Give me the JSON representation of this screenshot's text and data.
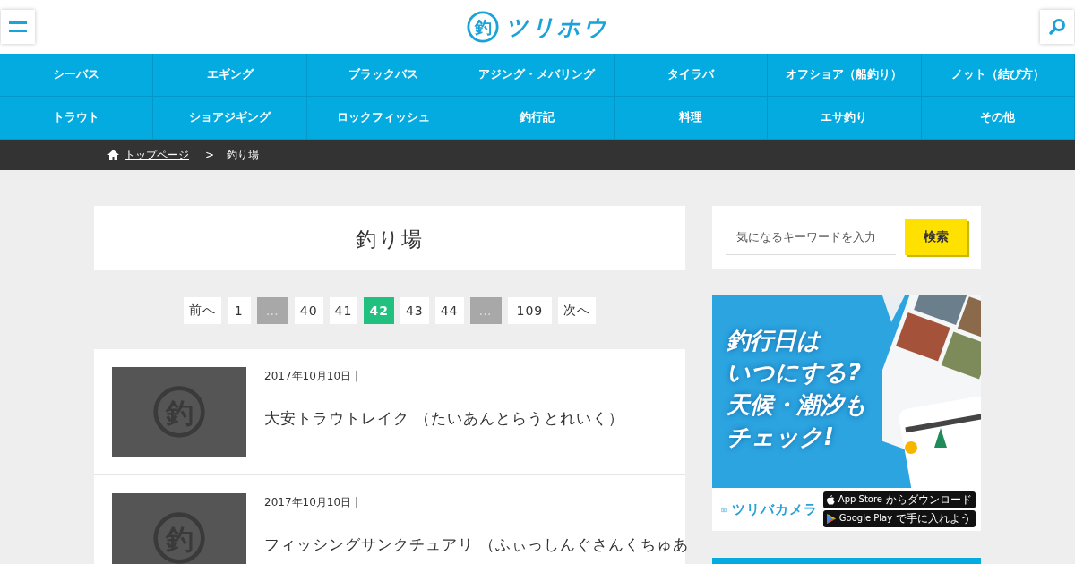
{
  "header": {
    "logo_mark": "釣",
    "logo_text": "ツリホウ"
  },
  "nav": [
    {
      "label": "シーバス"
    },
    {
      "label": "エギング"
    },
    {
      "label": "ブラックバス"
    },
    {
      "label": "アジング・メバリング"
    },
    {
      "label": "タイラバ"
    },
    {
      "label": "オフショア（船釣り）"
    },
    {
      "label": "ノット（結び方）"
    },
    {
      "label": "トラウト"
    },
    {
      "label": "ショアジギング"
    },
    {
      "label": "ロックフィッシュ"
    },
    {
      "label": "釣行記"
    },
    {
      "label": "料理"
    },
    {
      "label": "エサ釣り"
    },
    {
      "label": "その他"
    }
  ],
  "breadcrumb": {
    "home": "トップページ",
    "separator": ">",
    "current": "釣り場"
  },
  "page_title": "釣り場",
  "pagination": [
    {
      "kind": "link",
      "label": "前へ",
      "selected": false
    },
    {
      "kind": "link",
      "label": "1",
      "selected": false
    },
    {
      "kind": "ellipsis",
      "label": "…",
      "selected": false
    },
    {
      "kind": "link",
      "label": "40",
      "selected": false
    },
    {
      "kind": "link",
      "label": "41",
      "selected": false
    },
    {
      "kind": "link",
      "label": "42",
      "selected": true
    },
    {
      "kind": "link",
      "label": "43",
      "selected": false
    },
    {
      "kind": "link",
      "label": "44",
      "selected": false
    },
    {
      "kind": "ellipsis",
      "label": "…",
      "selected": false
    },
    {
      "kind": "link",
      "label": "109",
      "selected": false
    },
    {
      "kind": "link",
      "label": "次へ",
      "selected": false
    }
  ],
  "articles": [
    {
      "thumbnail_mark": "釣",
      "date": "2017年10月10日 |",
      "title": "大安トラウトレイク （たいあんとらうとれいく）"
    },
    {
      "thumbnail_mark": "釣",
      "date": "2017年10月10日 |",
      "title": "フィッシングサンクチュアリ （ふぃっしんぐさんくちゅあ"
    }
  ],
  "search": {
    "placeholder": "気になるキーワードを入力",
    "button": "検索"
  },
  "ad": {
    "headline": [
      "釣行日は",
      "いつにする?",
      "天候・潮汐も",
      "チェック!"
    ],
    "app_name": "ツリバカメラ",
    "stores": [
      {
        "kind": "apple",
        "label": "App Store",
        "sub": "からダウンロード"
      },
      {
        "kind": "google",
        "label": "Google Play",
        "sub": "で手に入れよう"
      }
    ]
  }
}
